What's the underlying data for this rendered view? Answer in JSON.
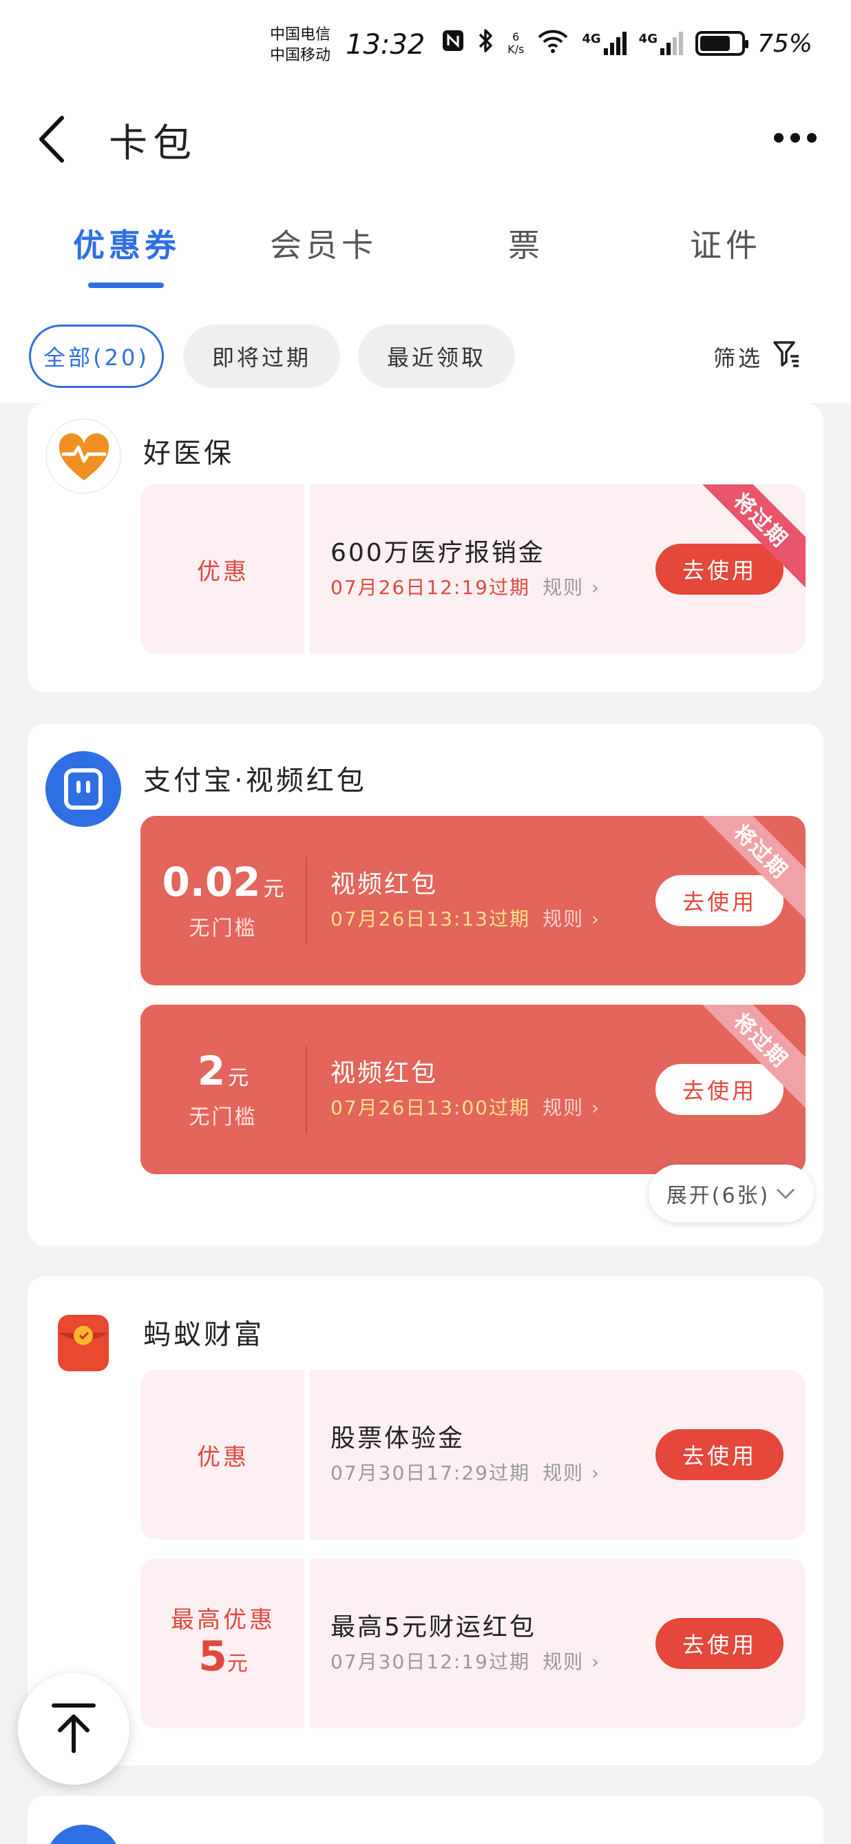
{
  "status_bar": {
    "carrier_1": "中国电信",
    "carrier_2": "中国移动",
    "time": "13:32",
    "net_speed_value": "6",
    "net_speed_unit": "K/s",
    "network_1": "4G",
    "network_2": "4G",
    "battery_percent": "75%"
  },
  "header": {
    "title": "卡包"
  },
  "tabs": [
    "优惠券",
    "会员卡",
    "票",
    "证件"
  ],
  "filters": {
    "all": "全部(20)",
    "expiring": "即将过期",
    "recent": "最近领取",
    "filter": "筛选"
  },
  "cards": [
    {
      "merchant": "好医保",
      "coupons": [
        {
          "kind": "优惠",
          "title": "600万医疗报销金",
          "expiry": "07月26日12:19过期",
          "rule": "规则",
          "button": "去使用",
          "badge": "将过期"
        }
      ]
    },
    {
      "merchant": "支付宝·视频红包",
      "coupons": [
        {
          "amount": "0.02",
          "unit": "元",
          "threshold": "无门槛",
          "title": "视频红包",
          "expiry": "07月26日13:13过期",
          "rule": "规则",
          "button": "去使用",
          "badge": "将过期"
        },
        {
          "amount": "2",
          "unit": "元",
          "threshold": "无门槛",
          "title": "视频红包",
          "expiry": "07月26日13:00过期",
          "rule": "规则",
          "button": "去使用",
          "badge": "将过期"
        }
      ],
      "expand": "展开(6张)"
    },
    {
      "merchant": "蚂蚁财富",
      "coupons": [
        {
          "kind": "优惠",
          "title": "股票体验金",
          "expiry": "07月30日17:29过期",
          "rule": "规则",
          "button": "去使用"
        },
        {
          "kind_top": "最高优惠",
          "amount": "5",
          "unit": "元",
          "title": "最高5元财运红包",
          "expiry": "07月30日12:19过期",
          "rule": "规则",
          "button": "去使用"
        }
      ]
    }
  ],
  "colors": {
    "accent_blue": "#2f6fe4",
    "coupon_red": "#e4655b",
    "button_red": "#e5473a",
    "coupon_pink": "#fdf0f2"
  }
}
